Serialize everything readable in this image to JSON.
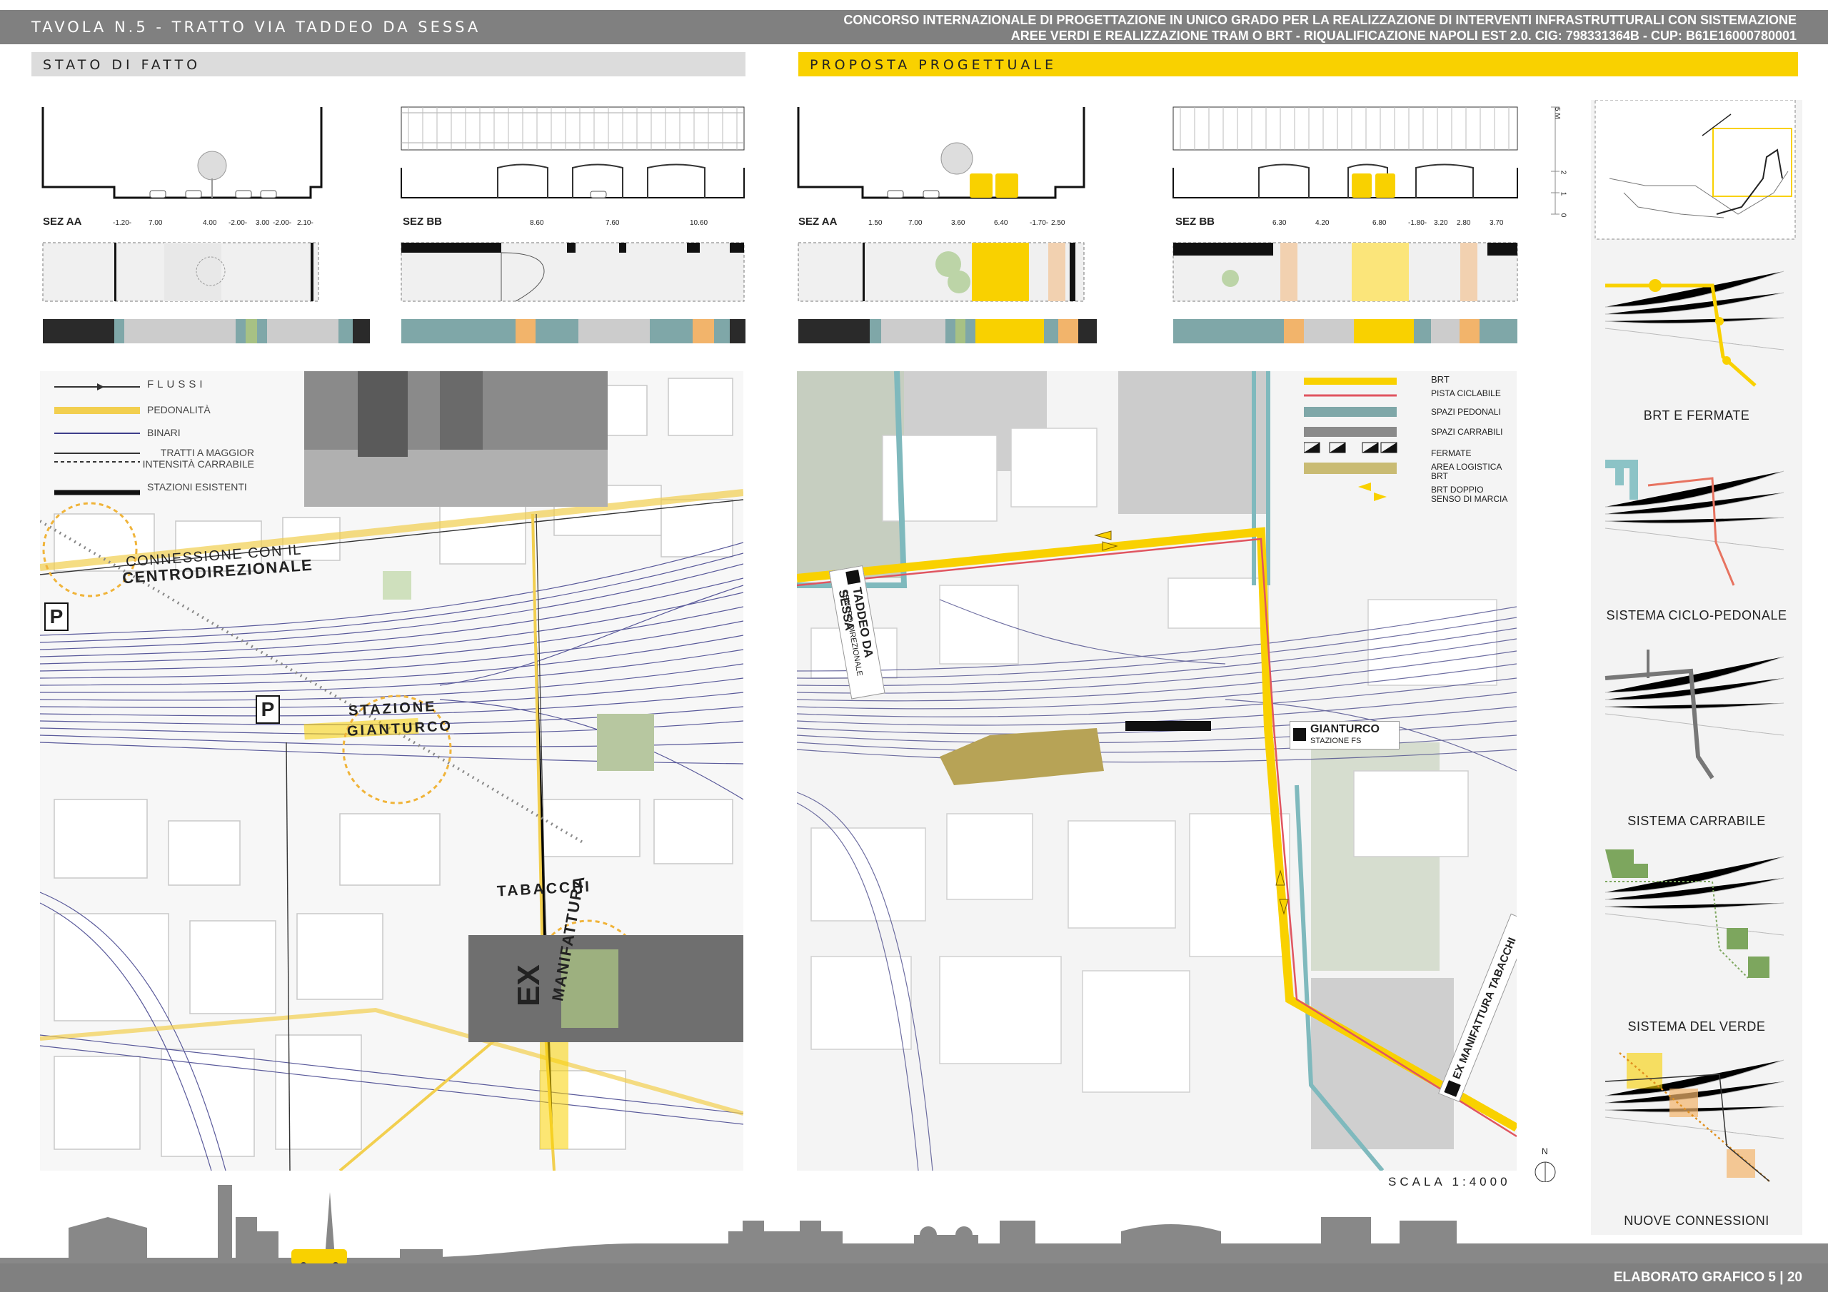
{
  "header": {
    "left_title": "TAVOLA N.5 - TRATTO VIA TADDEO DA SESSA",
    "right_line1": "CONCORSO INTERNAZIONALE DI PROGETTAZIONE IN UNICO GRADO PER LA REALIZZAZIONE DI INTERVENTI INFRASTRUTTURALI CON SISTEMAZIONE",
    "right_line2": "AREE VERDI E REALIZZAZIONE TRAM O BRT - RIQUALIFICAZIONE NAPOLI EST 2.0. CIG: 798331364B - CUP: B61E16000780001"
  },
  "sections": {
    "existing": "STATO DI FATTO",
    "proposal": "PROPOSTA PROGETTUALE"
  },
  "profiles": {
    "sez_aa": "SEZ AA",
    "sez_bb": "SEZ BB",
    "existing_aa_dims": [
      "-1.20-",
      "7.00",
      "4.00",
      "-2.00-",
      "3.00",
      "-2.00-",
      "2.10-"
    ],
    "existing_bb_dims": [
      "8.60",
      "7.60",
      "10.60"
    ],
    "proposal_aa_dims": [
      "1.50",
      "7.00",
      "3.60",
      "6.40",
      "-1.70-",
      "2.50"
    ],
    "proposal_bb_dims": [
      "6.30",
      "4.20",
      "6.80",
      "-1.80-",
      "3.20",
      "2.80",
      "3.70"
    ],
    "scale_labels": [
      "5 M",
      "2",
      "1",
      "0"
    ]
  },
  "existing_map": {
    "legend": [
      "FLUSSI",
      "PEDONALITÀ",
      "BINARI",
      "TRATTI A MAGGIOR INTENSITÀ CARRABILE",
      "STAZIONI ESISTENTI"
    ],
    "labels": {
      "connessione": "CONNESSIONE CON IL",
      "centro": "CENTRODIREZIONALE",
      "stazione": "STAZIONE",
      "gianturco": "GIANTURCO",
      "tabacchi": "TABACCHI",
      "ex": "EX",
      "manifattura": "MANIFATTURA",
      "parking": "P"
    }
  },
  "proposal_map": {
    "legend": [
      "BRT",
      "PISTA CICLABILE",
      "SPAZI PEDONALI",
      "SPAZI CARRABILI",
      "FERMATE",
      "AREA LOGISTICA BRT",
      "BRT DOPPIO SENSO DI MARCIA"
    ],
    "stops": {
      "taddeo": "TADDEO DA SESSA",
      "taddeo_sub": "CENTRO DIREZIONALE",
      "gianturco": "GIANTURCO",
      "gianturco_sub": "STAZIONE FS",
      "ex_manifattura": "EX MANIFATTURA TABACCHI"
    },
    "scale": "SCALA 1:4000",
    "north": "N"
  },
  "side_panel": [
    "BRT E FERMATE",
    "SISTEMA CICLO-PEDONALE",
    "SISTEMA CARRABILE",
    "SISTEMA DEL VERDE",
    "NUOVE CONNESSIONI"
  ],
  "footer": "ELABORATO GRAFICO 5 | 20",
  "colors": {
    "yellow": "#f9d100",
    "teal": "#7fa7a8",
    "orange": "#f2b46b",
    "dark": "#2a2a2a",
    "grey": "#808080",
    "green": "#a7c184"
  }
}
